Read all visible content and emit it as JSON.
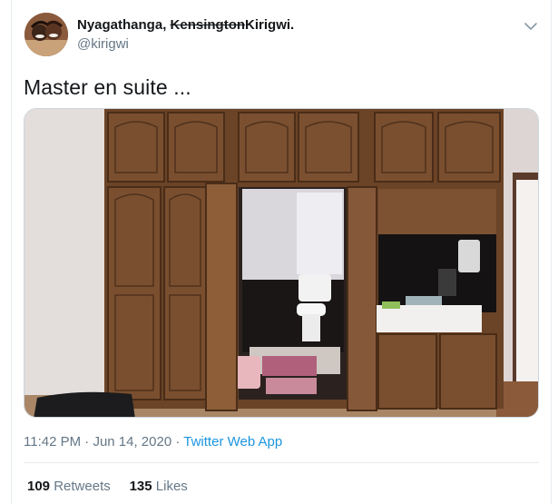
{
  "user": {
    "name_first": "Nyagathanga,",
    "name_struck": "Kensington",
    "name_last": "Kirigwi.",
    "handle": "@kirigwi"
  },
  "tweet": {
    "text": "Master en suite ..."
  },
  "meta": {
    "time": "11:42 PM",
    "sep1": "·",
    "date": "Jun 14, 2020",
    "sep2": "·",
    "app": "Twitter Web App"
  },
  "stats": {
    "retweets_count": "109",
    "retweets_label": "Retweets",
    "likes_count": "135",
    "likes_label": "Likes"
  },
  "icons": {
    "menu": "chevron-down-icon"
  },
  "colors": {
    "link": "#1b95e0",
    "muted": "#657786",
    "text": "#14171a"
  }
}
